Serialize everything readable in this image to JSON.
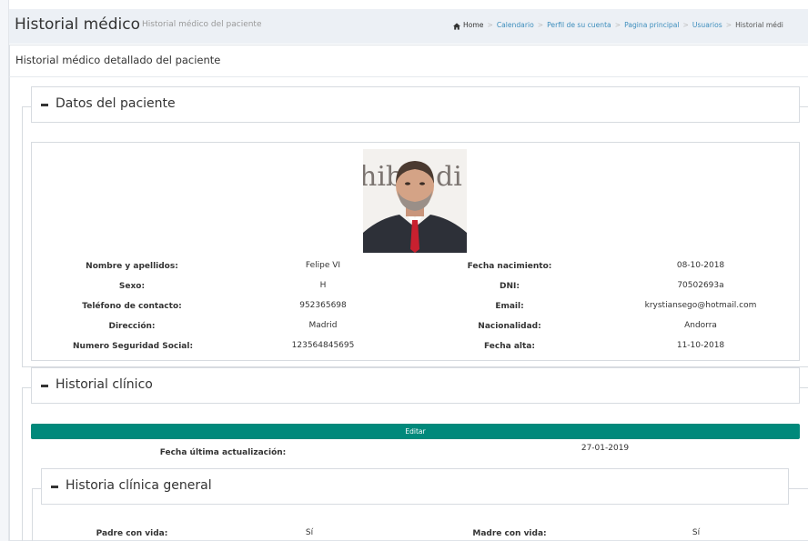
{
  "header": {
    "title": "Historial médico",
    "subtitle": "Historial médico del paciente",
    "breadcrumb": [
      {
        "label": "Home",
        "icon": "home-icon"
      },
      {
        "label": "Calendario"
      },
      {
        "label": "Perfil de su cuenta"
      },
      {
        "label": "Pagina principal"
      },
      {
        "label": "Usuarios"
      },
      {
        "label": "Historial médi"
      }
    ]
  },
  "main": {
    "box_title": "Historial médico detallado del paciente"
  },
  "datos": {
    "legend": "Datos del paciente",
    "fields": [
      {
        "label": "Nombre y apellidos:",
        "value": "Felipe VI",
        "label2": "Fecha nacimiento:",
        "value2": "08-10-2018"
      },
      {
        "label": "Sexo:",
        "value": "H",
        "label2": "DNI:",
        "value2": "70502693a"
      },
      {
        "label": "Teléfono de contacto:",
        "value": "952365698",
        "label2": "Email:",
        "value2": "krystiansego@hotmail.com"
      },
      {
        "label": "Dirección:",
        "value": "Madrid",
        "label2": "Nacionalidad:",
        "value2": "Andorra"
      },
      {
        "label": "Numero Seguridad Social:",
        "value": "123564845695",
        "label2": "Fecha alta:",
        "value2": "11-10-2018"
      }
    ]
  },
  "historial": {
    "legend": "Historial clínico",
    "edit_label": "Editar",
    "update_label": "Fecha última actualización:",
    "update_value": "27-01-2019"
  },
  "general": {
    "legend": "Historia clínica general",
    "fields": [
      {
        "label": "Padre con vida:",
        "value": "Sí",
        "label2": "Madre con vida:",
        "value2": "Sí"
      }
    ]
  },
  "colors": {
    "accent": "#00897b",
    "link": "#3c8dbc"
  }
}
